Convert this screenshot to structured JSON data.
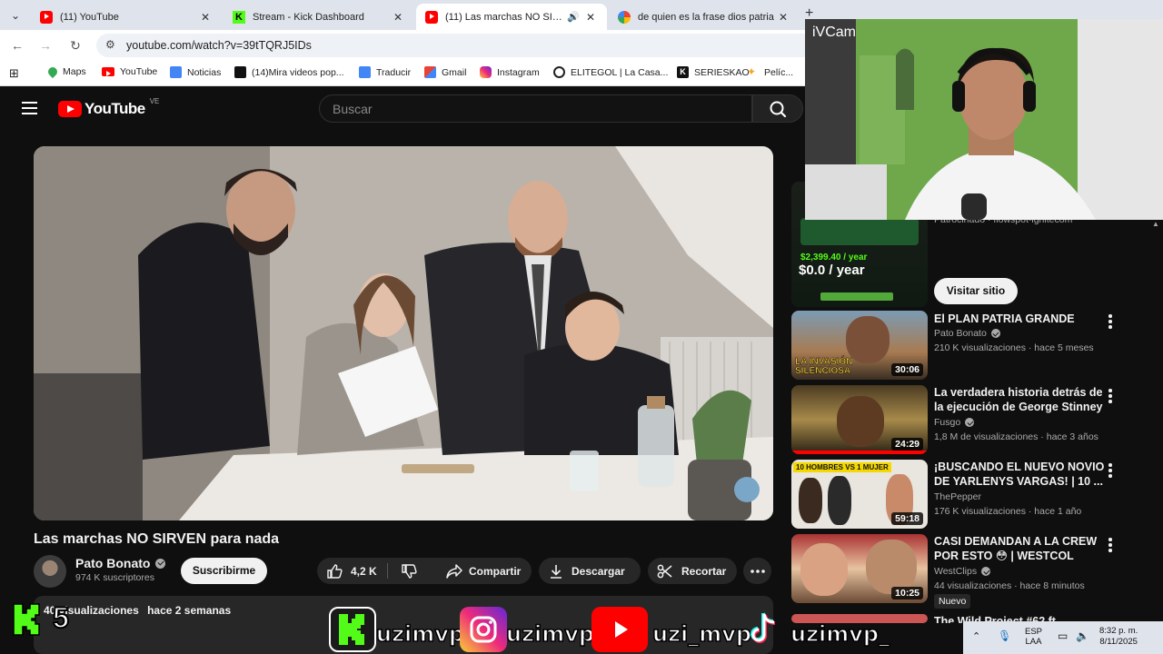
{
  "tabs": [
    {
      "title": "(11) YouTube",
      "icon": "youtube-favicon"
    },
    {
      "title": "Stream - Kick Dashboard",
      "icon": "kick-favicon"
    },
    {
      "title": "(11) Las marchas NO SIRVEN",
      "icon": "youtube-favicon",
      "active": true
    },
    {
      "title": "de quien es la frase dios patria",
      "icon": "google-favicon"
    }
  ],
  "address": {
    "url": "youtube.com/watch?v=39tTQRJ5IDs"
  },
  "bookmarks": [
    {
      "label": "Maps",
      "icon": "maps-icon"
    },
    {
      "label": "YouTube",
      "icon": "youtube-icon"
    },
    {
      "label": "Noticias",
      "icon": "news-icon"
    },
    {
      "label": "(14)Mira videos pop...",
      "icon": "tiktok-icon"
    },
    {
      "label": "Traducir",
      "icon": "translate-icon"
    },
    {
      "label": "Gmail",
      "icon": "gmail-icon"
    },
    {
      "label": "Instagram",
      "icon": "instagram-icon"
    },
    {
      "label": "ELITEGOL | La Casa...",
      "icon": "soccer-ball-icon"
    },
    {
      "label": "SERIESKAO",
      "icon": "k-icon"
    },
    {
      "label": "Pelíc...",
      "icon": "star-icon"
    }
  ],
  "youtube": {
    "logo_text": "YouTube",
    "country_code": "VE",
    "search_placeholder": "Buscar"
  },
  "video": {
    "title": "Las marchas NO SIRVEN para nada",
    "channel": "Pato Bonato",
    "subscribers": "974 K suscriptores",
    "subscribe_label": "Suscribirme",
    "likes": "4,2 K",
    "share_label": "Compartir",
    "download_label": "Descargar",
    "clip_label": "Recortar",
    "views": "40",
    "views_suffix": "visualizaciones",
    "age": "hace 2 semanas"
  },
  "sidebar": {
    "sponsored_partial": "Patrocinado · flowspot-ignitecom",
    "ad_price_old": "$2,399.40 / year",
    "ad_price_new": "$0.0 / year",
    "visit_label": "Visitar sitio",
    "items": [
      {
        "title": "El PLAN PATRIA GRANDE",
        "channel": "Pato Bonato",
        "verified": true,
        "meta": "210 K visualizaciones · hace 5 meses",
        "duration": "30:06",
        "thumb_text": "LA INVASIÓN SILENCIOSA"
      },
      {
        "title": "La verdadera historia detrás de la ejecución de George Stinney",
        "channel": "Fusgo",
        "verified": true,
        "meta": "1,8 M de visualizaciones · hace 3 años",
        "duration": "24:29"
      },
      {
        "title": "¡BUSCANDO EL NUEVO NOVIO DE YARLENYS VARGAS! | 10 ...",
        "channel": "ThePepper",
        "verified": false,
        "meta": "176 K visualizaciones · hace 1 año",
        "duration": "59:18",
        "thumb_text": "10 HOMBRES VS 1 MUJER"
      },
      {
        "title": "CASI DEMANDAN A LA CREW POR ESTO 😳 | WESTCOL",
        "channel": "WestClips",
        "verified": true,
        "meta": "44 visualizaciones · hace 8 minutos",
        "duration": "10:25",
        "badge": "Nuevo"
      },
      {
        "title": "The Wild Project #62 ft",
        "channel": "",
        "meta": ""
      }
    ]
  },
  "webcam": {
    "label": "iVCam"
  },
  "stream_overlay": {
    "kick_count": "5",
    "handles": [
      "uzimvp",
      "uzimvp",
      "uzi_mvp",
      "uzimvp_"
    ]
  },
  "taskbar": {
    "lang": "ESP",
    "region": "LAA",
    "time": "8:32 p. m.",
    "date": "8/11/2025"
  },
  "colors": {
    "youtube_red": "#ff0000",
    "kick_green": "#53fc18",
    "bg": "#0f0f0f"
  }
}
